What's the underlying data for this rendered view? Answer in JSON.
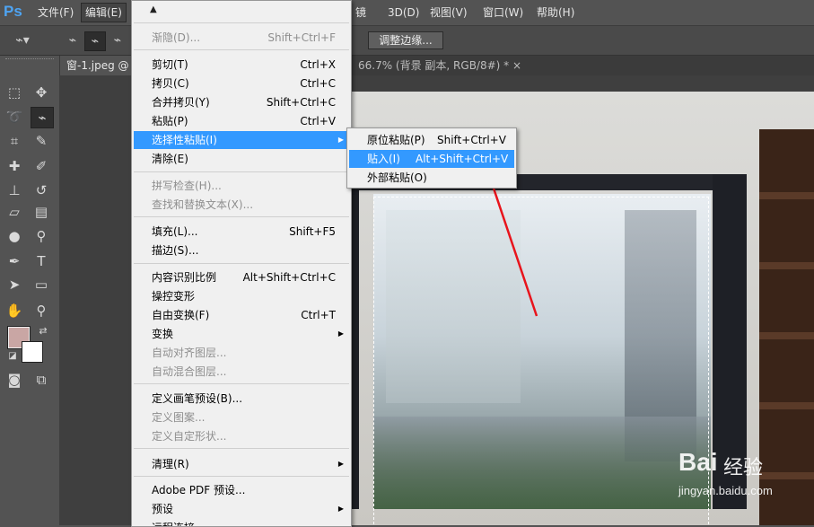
{
  "menubar": {
    "logo": "Ps",
    "items": [
      {
        "label": "文件(F)"
      },
      {
        "label": "编辑(E)"
      },
      {
        "label": "镜"
      },
      {
        "label": "3D(D)"
      },
      {
        "label": "视图(V)"
      },
      {
        "label": "窗口(W)"
      },
      {
        "label": "帮助(H)"
      }
    ],
    "partial_label": "(T)"
  },
  "options": {
    "refine_edge": "调整边缘..."
  },
  "tabs": [
    {
      "label": "窗-1.jpeg @"
    },
    {
      "label": "66.7% (背景 副本, RGB/8#) *"
    }
  ],
  "tab_close": "×",
  "edit_menu": {
    "scroll_arrow": "▲",
    "items": [
      {
        "label": "渐隐(D)...",
        "shortcut": "Shift+Ctrl+F",
        "disabled": true
      },
      {
        "label": "剪切(T)",
        "shortcut": "Ctrl+X"
      },
      {
        "label": "拷贝(C)",
        "shortcut": "Ctrl+C"
      },
      {
        "label": "合并拷贝(Y)",
        "shortcut": "Shift+Ctrl+C"
      },
      {
        "label": "粘贴(P)",
        "shortcut": "Ctrl+V"
      },
      {
        "label": "选择性粘贴(I)",
        "shortcut": "",
        "submenu": true,
        "highlighted": true
      },
      {
        "label": "清除(E)",
        "shortcut": ""
      },
      {
        "label": "拼写检查(H)...",
        "shortcut": "",
        "disabled": true
      },
      {
        "label": "查找和替换文本(X)...",
        "shortcut": "",
        "disabled": true
      },
      {
        "label": "填充(L)...",
        "shortcut": "Shift+F5"
      },
      {
        "label": "描边(S)...",
        "shortcut": ""
      },
      {
        "label": "内容识别比例",
        "shortcut": "Alt+Shift+Ctrl+C"
      },
      {
        "label": "操控变形",
        "shortcut": ""
      },
      {
        "label": "自由变换(F)",
        "shortcut": "Ctrl+T"
      },
      {
        "label": "变换",
        "shortcut": "",
        "submenu": true
      },
      {
        "label": "自动对齐图层...",
        "shortcut": "",
        "disabled": true
      },
      {
        "label": "自动混合图层...",
        "shortcut": "",
        "disabled": true
      },
      {
        "label": "定义画笔预设(B)...",
        "shortcut": ""
      },
      {
        "label": "定义图案...",
        "shortcut": "",
        "disabled": true
      },
      {
        "label": "定义自定形状...",
        "shortcut": "",
        "disabled": true
      },
      {
        "label": "清理(R)",
        "shortcut": "",
        "submenu": true
      },
      {
        "label": "Adobe PDF 预设...",
        "shortcut": ""
      },
      {
        "label": "预设",
        "shortcut": "",
        "submenu": true
      },
      {
        "label": "远程连接...",
        "shortcut": ""
      }
    ]
  },
  "paste_submenu": {
    "items": [
      {
        "label": "原位粘贴(P)",
        "shortcut": "Shift+Ctrl+V"
      },
      {
        "label": "贴入(I)",
        "shortcut": "Alt+Shift+Ctrl+V",
        "highlighted": true
      },
      {
        "label": "外部粘贴(O)",
        "shortcut": ""
      }
    ]
  },
  "tools": {
    "icons": [
      "marquee-icon",
      "move-icon",
      "lasso-icon",
      "quick-select-icon",
      "crop-icon",
      "eyedropper-icon",
      "healing-icon",
      "brush-icon",
      "stamp-icon",
      "history-brush-icon",
      "eraser-icon",
      "gradient-icon",
      "blur-icon",
      "dodge-icon",
      "pen-icon",
      "type-icon",
      "path-select-icon",
      "shape-icon",
      "hand-icon",
      "zoom-icon",
      "quick-mask-icon",
      "screen-mode-icon"
    ],
    "fg_color": "#c9a6a4",
    "bg_color": "#ffffff"
  },
  "watermark": {
    "brand": "Bai",
    "brand2": "经验",
    "url": "jingyan.baidu.com"
  },
  "colors": {
    "highlight": "#3399ff",
    "menu_bg": "#f0f0f0",
    "ui_gray": "#535353",
    "arrow_red": "#e8141c"
  }
}
